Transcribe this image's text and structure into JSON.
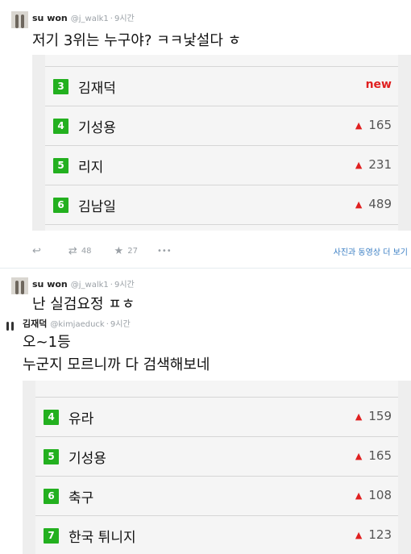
{
  "tweet1": {
    "name": "su won",
    "handle": "@j_walk1",
    "time": "9시간",
    "text": "저기 3위는 누구야? ㅋㅋ낯설다 ㅎ",
    "card_rows": [
      {
        "rank": "3",
        "keyword": "김재덕",
        "change": "new"
      },
      {
        "rank": "4",
        "keyword": "기성용",
        "change": "165"
      },
      {
        "rank": "5",
        "keyword": "리지",
        "change": "231"
      },
      {
        "rank": "6",
        "keyword": "김남일",
        "change": "489"
      }
    ],
    "retweets": "48",
    "favorites": "27",
    "more": "•••",
    "view_media": "사진과 동영상 더 보기"
  },
  "tweet2": {
    "name": "su won",
    "handle": "@j_walk1",
    "time": "9시간",
    "text": "난 실검요정 ㅍㅎ"
  },
  "tweet3": {
    "name": "김재덕",
    "handle": "@kimjaeduck",
    "time": "9시간",
    "text_line1": "오~1등",
    "text_line2": "누군지 모르니까 다 검색해보네",
    "card_rows": [
      {
        "rank": "4",
        "keyword": "유라",
        "change": "159"
      },
      {
        "rank": "5",
        "keyword": "기성용",
        "change": "165"
      },
      {
        "rank": "6",
        "keyword": "축구",
        "change": "108"
      },
      {
        "rank": "7",
        "keyword": "한국 튀니지",
        "change": "123"
      }
    ]
  },
  "icons": {
    "up": "▲",
    "reply": "↩",
    "retweet": "⇄",
    "star": "★"
  },
  "colors": {
    "rank_badge": "#23b01f",
    "up_arrow": "#e02020",
    "link": "#3b7fc4"
  }
}
